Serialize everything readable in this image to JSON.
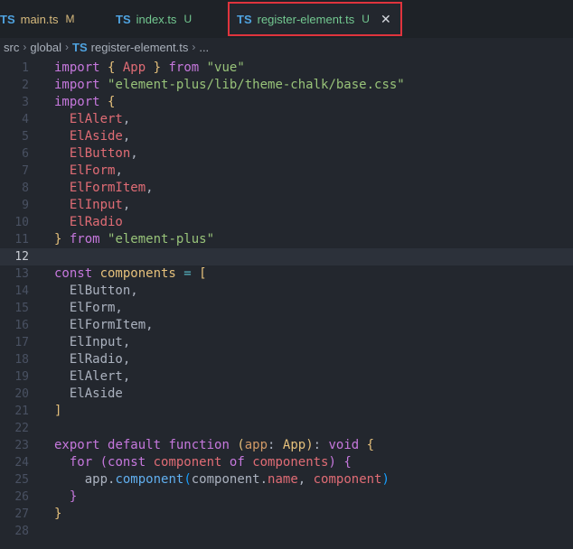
{
  "tabs": [
    {
      "lang": "TS",
      "name": "main.ts",
      "status": "M",
      "status_color": "#d7ba7d"
    },
    {
      "lang": "TS",
      "name": "index.ts",
      "status": "U",
      "status_color": "#73c991"
    },
    {
      "lang": "TS",
      "name": "register-element.ts",
      "status": "U",
      "status_color": "#73c991",
      "close": "✕"
    }
  ],
  "breadcrumb": {
    "segments": [
      "src",
      "global"
    ],
    "file_lang": "TS",
    "file": "register-element.ts",
    "more": "..."
  },
  "editor": {
    "current_line": 12,
    "line_numbers": [
      "1",
      "2",
      "3",
      "4",
      "5",
      "6",
      "7",
      "8",
      "9",
      "10",
      "11",
      "12",
      "13",
      "14",
      "15",
      "16",
      "17",
      "18",
      "19",
      "20",
      "21",
      "22",
      "23",
      "24",
      "25",
      "26",
      "27",
      "28"
    ],
    "lines": [
      [
        {
          "t": "import ",
          "c": "kw"
        },
        {
          "t": "{ ",
          "c": "br1"
        },
        {
          "t": "App",
          "c": "var"
        },
        {
          "t": " } ",
          "c": "br1"
        },
        {
          "t": "from ",
          "c": "kw"
        },
        {
          "t": "\"vue\"",
          "c": "str"
        }
      ],
      [
        {
          "t": "import ",
          "c": "kw"
        },
        {
          "t": "\"element-plus/lib/theme-chalk/base.css\"",
          "c": "str"
        }
      ],
      [
        {
          "t": "import ",
          "c": "kw"
        },
        {
          "t": "{",
          "c": "br1"
        }
      ],
      [
        {
          "t": "  ElAlert",
          "c": "var"
        },
        {
          "t": ",",
          "c": "plain"
        }
      ],
      [
        {
          "t": "  ElAside",
          "c": "var"
        },
        {
          "t": ",",
          "c": "plain"
        }
      ],
      [
        {
          "t": "  ElButton",
          "c": "var"
        },
        {
          "t": ",",
          "c": "plain"
        }
      ],
      [
        {
          "t": "  ElForm",
          "c": "var"
        },
        {
          "t": ",",
          "c": "plain"
        }
      ],
      [
        {
          "t": "  ElFormItem",
          "c": "var"
        },
        {
          "t": ",",
          "c": "plain"
        }
      ],
      [
        {
          "t": "  ElInput",
          "c": "var"
        },
        {
          "t": ",",
          "c": "plain"
        }
      ],
      [
        {
          "t": "  ElRadio",
          "c": "var"
        }
      ],
      [
        {
          "t": "} ",
          "c": "br1"
        },
        {
          "t": "from ",
          "c": "kw"
        },
        {
          "t": "\"element-plus\"",
          "c": "str"
        }
      ],
      [],
      [
        {
          "t": "const ",
          "c": "kw"
        },
        {
          "t": "components",
          "c": "ty"
        },
        {
          "t": " = ",
          "c": "op"
        },
        {
          "t": "[",
          "c": "br1"
        }
      ],
      [
        {
          "t": "  ElButton,",
          "c": "plain"
        }
      ],
      [
        {
          "t": "  ElForm,",
          "c": "plain"
        }
      ],
      [
        {
          "t": "  ElFormItem,",
          "c": "plain"
        }
      ],
      [
        {
          "t": "  ElInput,",
          "c": "plain"
        }
      ],
      [
        {
          "t": "  ElRadio,",
          "c": "plain"
        }
      ],
      [
        {
          "t": "  ElAlert,",
          "c": "plain"
        }
      ],
      [
        {
          "t": "  ElAside",
          "c": "plain"
        }
      ],
      [
        {
          "t": "]",
          "c": "br1"
        }
      ],
      [],
      [
        {
          "t": "export ",
          "c": "kw"
        },
        {
          "t": "default ",
          "c": "kw"
        },
        {
          "t": "function ",
          "c": "kw"
        },
        {
          "t": "(",
          "c": "br1"
        },
        {
          "t": "app",
          "c": "prm"
        },
        {
          "t": ": ",
          "c": "plain"
        },
        {
          "t": "App",
          "c": "ty"
        },
        {
          "t": ")",
          "c": "br1"
        },
        {
          "t": ": ",
          "c": "plain"
        },
        {
          "t": "void ",
          "c": "kw"
        },
        {
          "t": "{",
          "c": "br1"
        }
      ],
      [
        {
          "t": "  for ",
          "c": "kw"
        },
        {
          "t": "(",
          "c": "br2"
        },
        {
          "t": "const ",
          "c": "kw"
        },
        {
          "t": "component ",
          "c": "var"
        },
        {
          "t": "of ",
          "c": "kw"
        },
        {
          "t": "components",
          "c": "var"
        },
        {
          "t": ") ",
          "c": "br2"
        },
        {
          "t": "{",
          "c": "br2"
        }
      ],
      [
        {
          "t": "    app",
          "c": "plain"
        },
        {
          "t": ".",
          "c": "plain"
        },
        {
          "t": "component",
          "c": "fn"
        },
        {
          "t": "(",
          "c": "br3"
        },
        {
          "t": "component",
          "c": "plain"
        },
        {
          "t": ".",
          "c": "plain"
        },
        {
          "t": "name",
          "c": "var"
        },
        {
          "t": ", ",
          "c": "plain"
        },
        {
          "t": "component",
          "c": "var"
        },
        {
          "t": ")",
          "c": "br3"
        }
      ],
      [
        {
          "t": "  }",
          "c": "br2"
        }
      ],
      [
        {
          "t": "}",
          "c": "br1"
        }
      ],
      []
    ]
  }
}
